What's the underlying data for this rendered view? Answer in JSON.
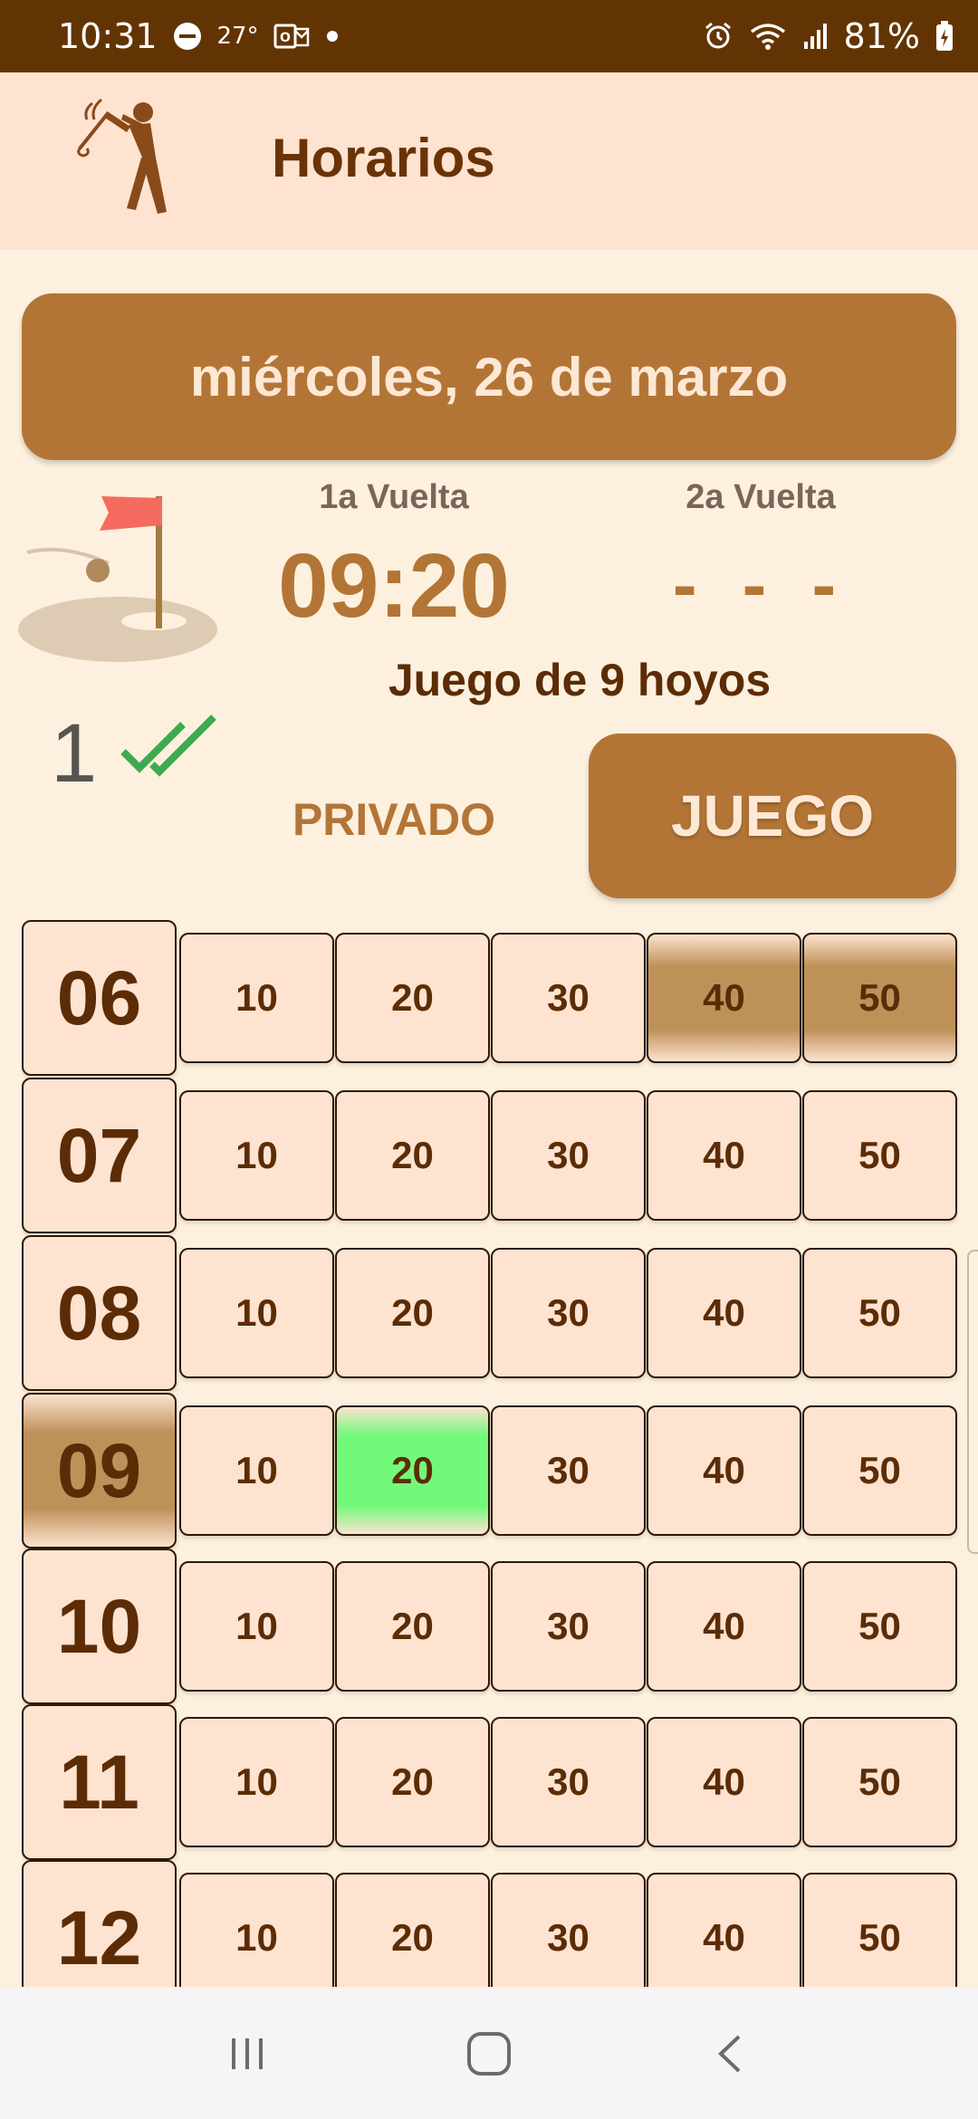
{
  "status_bar": {
    "time": "10:31",
    "temperature": "27°",
    "battery": "81%"
  },
  "app_bar": {
    "title": "Horarios"
  },
  "date_banner": {
    "text": "miércoles, 26 de marzo"
  },
  "rounds": {
    "first_label": "1a Vuelta",
    "first_time": "09:20",
    "second_label": "2a Vuelta",
    "second_time": "- - -"
  },
  "game_type": "Juego de 9 hoyos",
  "player_count": "1",
  "buttons": {
    "privado": "PRIVADO",
    "juego": "JUEGO"
  },
  "schedule": {
    "past_color": "#be9159",
    "selected_color": "#73f97a",
    "rows": [
      {
        "hour": "06",
        "minutes": [
          "10",
          "20",
          "30",
          "40",
          "50"
        ],
        "past_minutes": [
          "40",
          "50"
        ]
      },
      {
        "hour": "07",
        "minutes": [
          "10",
          "20",
          "30",
          "40",
          "50"
        ]
      },
      {
        "hour": "08",
        "minutes": [
          "10",
          "20",
          "30",
          "40",
          "50"
        ]
      },
      {
        "hour": "09",
        "minutes": [
          "10",
          "20",
          "30",
          "40",
          "50"
        ],
        "hour_highlighted": true,
        "selected_minute": "20"
      },
      {
        "hour": "10",
        "minutes": [
          "10",
          "20",
          "30",
          "40",
          "50"
        ]
      },
      {
        "hour": "11",
        "minutes": [
          "10",
          "20",
          "30",
          "40",
          "50"
        ]
      },
      {
        "hour": "12",
        "minutes": [
          "10",
          "20",
          "30",
          "40",
          "50"
        ]
      }
    ]
  },
  "colors": {
    "status_bar": "#633403",
    "app_bar": "#fde3d0",
    "background": "#fdf0de",
    "accent": "#b37536",
    "text_dark": "#5b2c05"
  },
  "icons": {
    "logo": "golfer-icon",
    "illustration": "golf-flag-icon",
    "check": "double-check-icon",
    "nav_recent": "recent-apps-icon",
    "nav_home": "home-icon",
    "nav_back": "back-icon"
  }
}
